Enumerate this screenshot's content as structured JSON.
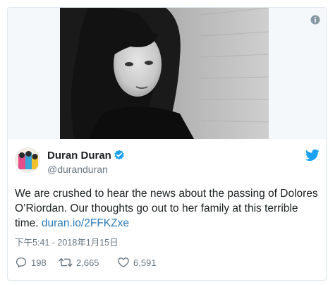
{
  "tweet": {
    "author": {
      "name": "Duran Duran",
      "handle": "@duranduran"
    },
    "text": "We are crushed to hear the news about the passing of Dolores O’Riordan. Our thoughts go out to her family at this terrible time. ",
    "link": "duran.io/2FFKZxe",
    "timestamp": "下午5:41 - 2018年1月15日",
    "stats": {
      "replies": "198",
      "retweets": "2,665",
      "likes": "6,591"
    }
  },
  "colors": {
    "link": "#2b7bb9",
    "twitter_blue": "#1da1f2",
    "muted": "#697882",
    "border": "#e1e8ed"
  },
  "icons": [
    "info-icon",
    "verified-badge-icon",
    "twitter-bird-icon",
    "reply-icon",
    "retweet-icon",
    "like-icon"
  ]
}
